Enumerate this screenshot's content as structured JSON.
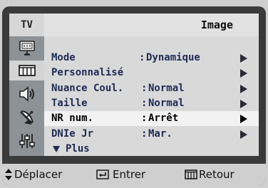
{
  "header": {
    "tv_tab": "TV",
    "title": "Image"
  },
  "sidebar": {
    "items": [
      {
        "icon": "tv-antenna-icon",
        "active": false
      },
      {
        "icon": "picture-icon",
        "active": true
      },
      {
        "icon": "speaker-icon",
        "active": false
      },
      {
        "icon": "satellite-dish-icon",
        "active": false
      },
      {
        "icon": "settings-sliders-icon",
        "active": false
      }
    ]
  },
  "menu": {
    "items": [
      {
        "label": "Mode",
        "separator": ":",
        "value": "Dynamique",
        "arrow": true
      },
      {
        "label": "Personnalisé",
        "separator": "",
        "value": "",
        "arrow": true
      },
      {
        "label": "Nuance Coul.",
        "separator": ":",
        "value": "Normal",
        "arrow": true
      },
      {
        "label": "Taille",
        "separator": ":",
        "value": "Normal",
        "arrow": true
      },
      {
        "label": "NR num.",
        "separator": ":",
        "value": "Arrêt",
        "arrow": true,
        "highlighted": true
      },
      {
        "label": "DNIe Jr",
        "separator": ":",
        "value": "Mar.",
        "arrow": true
      }
    ],
    "more_label": "Plus"
  },
  "footer": {
    "move_label": "Déplacer",
    "enter_label": "Entrer",
    "return_label": "Retour"
  }
}
